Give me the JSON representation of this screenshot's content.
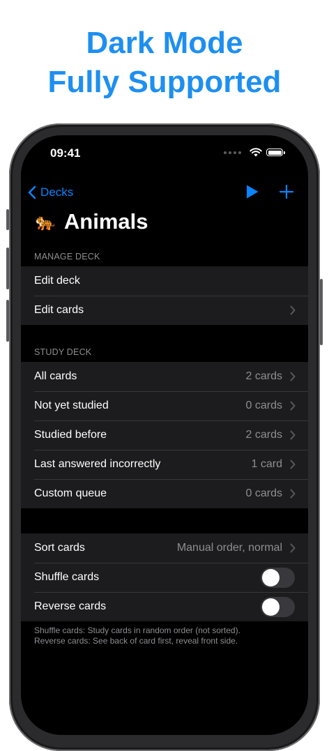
{
  "promo": {
    "line1": "Dark Mode",
    "line2": "Fully Supported"
  },
  "status_bar": {
    "time": "09:41"
  },
  "nav": {
    "back_label": "Decks"
  },
  "deck": {
    "emoji": "🐅",
    "title": "Animals"
  },
  "manage_section": {
    "header": "MANAGE DECK",
    "items": [
      {
        "label": "Edit deck"
      },
      {
        "label": "Edit cards"
      }
    ]
  },
  "study_section": {
    "header": "STUDY DECK",
    "items": [
      {
        "label": "All cards",
        "value": "2 cards"
      },
      {
        "label": "Not yet studied",
        "value": "0 cards"
      },
      {
        "label": "Studied before",
        "value": "2 cards"
      },
      {
        "label": "Last answered incorrectly",
        "value": "1 card"
      },
      {
        "label": "Custom queue",
        "value": "0 cards"
      }
    ]
  },
  "options_section": {
    "sort_label": "Sort cards",
    "sort_value": "Manual order, normal",
    "shuffle_label": "Shuffle cards",
    "shuffle_on": false,
    "reverse_label": "Reverse cards",
    "reverse_on": false,
    "footer_line1": "Shuffle cards: Study cards in random order (not sorted).",
    "footer_line2": "Reverse cards: See back of card first, reveal front side."
  },
  "colors": {
    "accent": "#0a84ff",
    "promo_blue": "#1e8ff0",
    "background": "#000000",
    "cell": "#1c1c1e",
    "secondary_text": "#8e8e93"
  }
}
